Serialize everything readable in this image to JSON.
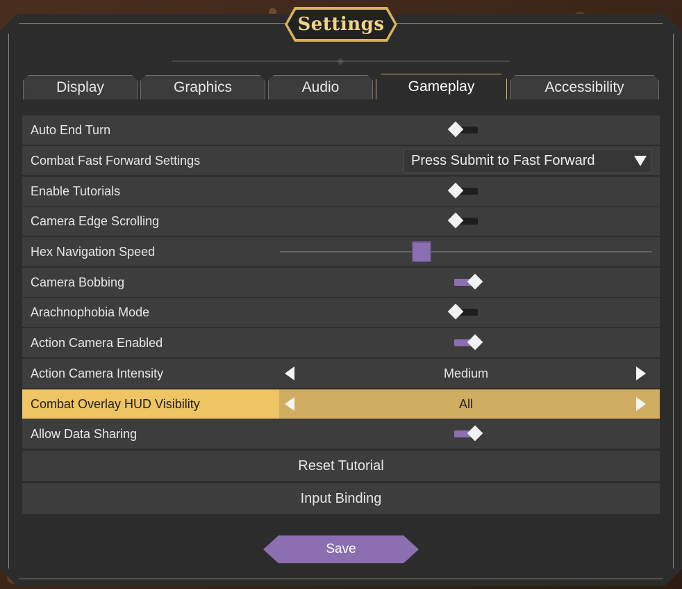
{
  "title": "Settings",
  "tabs": [
    {
      "label": "Display"
    },
    {
      "label": "Graphics"
    },
    {
      "label": "Audio"
    },
    {
      "label": "Gameplay"
    },
    {
      "label": "Accessibility"
    }
  ],
  "active_tab": "Gameplay",
  "settings": {
    "auto_end_turn": {
      "label": "Auto End Turn",
      "value": false
    },
    "combat_fast_forward": {
      "label": "Combat Fast Forward Settings",
      "value": "Press Submit to Fast Forward"
    },
    "enable_tutorials": {
      "label": "Enable Tutorials",
      "value": false
    },
    "camera_edge_scrolling": {
      "label": "Camera Edge Scrolling",
      "value": false
    },
    "hex_navigation_speed": {
      "label": "Hex Navigation Speed",
      "value": 0.38
    },
    "camera_bobbing": {
      "label": "Camera Bobbing",
      "value": true
    },
    "arachnophobia_mode": {
      "label": "Arachnophobia Mode",
      "value": false
    },
    "action_camera_enabled": {
      "label": "Action Camera Enabled",
      "value": true
    },
    "action_camera_intensity": {
      "label": "Action Camera Intensity",
      "value": "Medium"
    },
    "combat_overlay_hud": {
      "label": "Combat Overlay HUD Visibility",
      "value": "All"
    },
    "allow_data_sharing": {
      "label": "Allow Data Sharing",
      "value": true
    }
  },
  "actions": {
    "reset_tutorial": "Reset Tutorial",
    "input_binding": "Input Binding"
  },
  "save_label": "Save",
  "colors": {
    "accent_purple": "#8b6fb0",
    "highlight_gold": "#efc462",
    "frame_gold": "#d8b25c",
    "panel_bg": "#2c2c2c",
    "row_bg": "#3d3d3d"
  }
}
